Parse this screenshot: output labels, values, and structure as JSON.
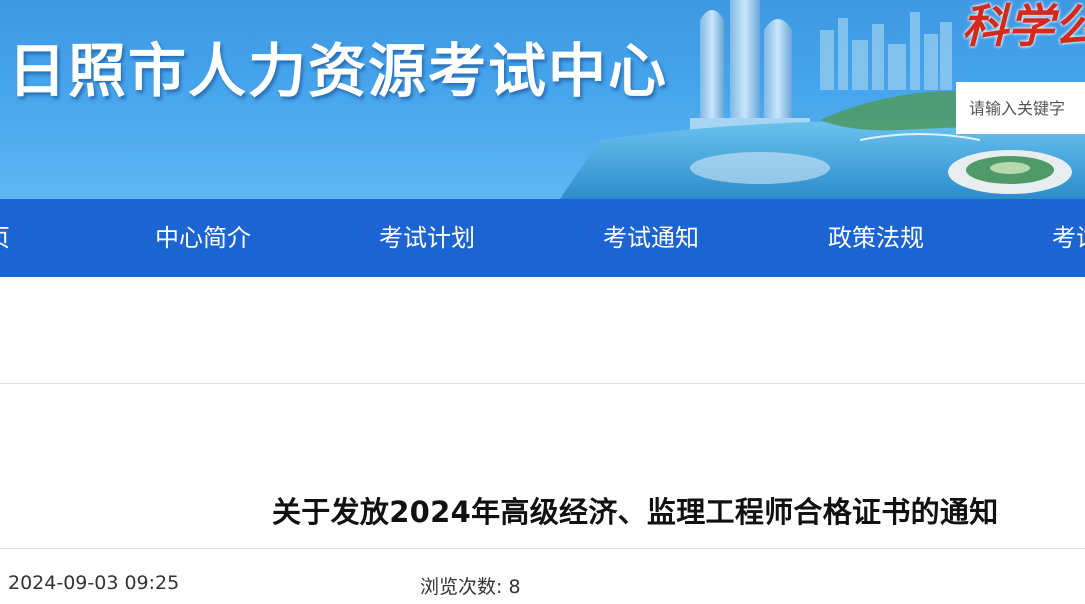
{
  "header": {
    "site_title": "日照市人力资源考试中心",
    "slogan": "科学公",
    "search": {
      "placeholder": "请输入关键字",
      "value": ""
    }
  },
  "nav": {
    "items": [
      {
        "label": "页"
      },
      {
        "label": "中心简介"
      },
      {
        "label": "考试计划"
      },
      {
        "label": "考试通知"
      },
      {
        "label": "政策法规"
      },
      {
        "label": "考试"
      }
    ]
  },
  "article": {
    "title": "关于发放2024年高级经济、监理工程师合格证书的通知",
    "published": "2024-09-03 09:25",
    "views_label": "浏览次数:",
    "views_count": "8"
  },
  "colors": {
    "banner_sky": "#46a5ec",
    "nav_background": "#1d64d3",
    "slogan_red": "#d42a1e",
    "text_dark": "#111111"
  }
}
